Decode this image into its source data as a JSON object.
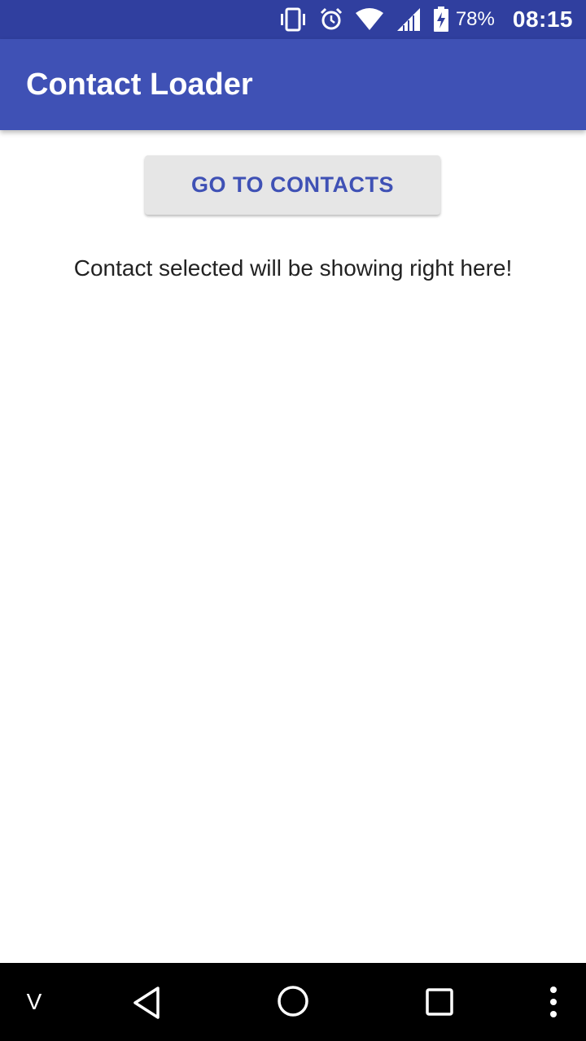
{
  "status_bar": {
    "battery_percent": "78%",
    "time": "08:15",
    "icons": [
      "vibrate-icon",
      "alarm-icon",
      "wifi-icon",
      "cell-signal-icon",
      "battery-charging-icon"
    ]
  },
  "app_bar": {
    "title": "Contact Loader"
  },
  "main": {
    "button_label": "GO TO CONTACTS",
    "message": "Contact selected will be showing right here!"
  },
  "nav_bar": {
    "left_label": "V",
    "icons": [
      "back-icon",
      "home-icon",
      "recents-icon",
      "menu-icon"
    ]
  },
  "colors": {
    "status_bar": "#303F9F",
    "primary": "#3F51B5",
    "button_bg": "#E6E6E6",
    "text": "#222222"
  }
}
